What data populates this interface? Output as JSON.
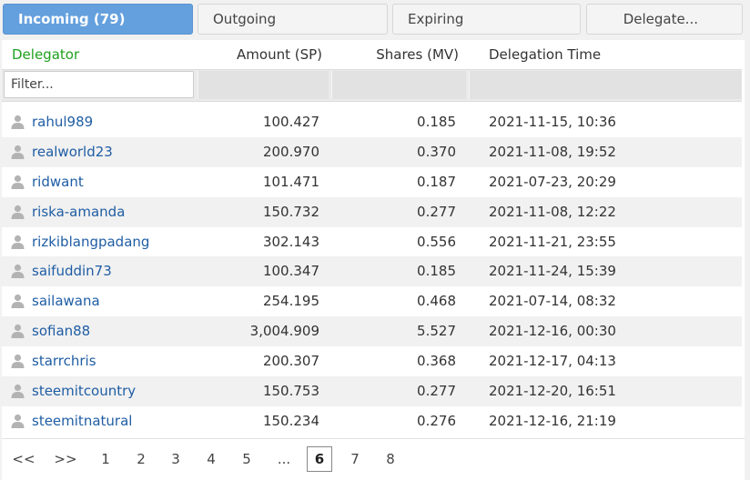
{
  "tabs": {
    "incoming": "Incoming (79)",
    "outgoing": "Outgoing",
    "expiring": "Expiring",
    "delegate": "Delegate..."
  },
  "table": {
    "headers": {
      "delegator": "Delegator",
      "amount": "Amount (SP)",
      "shares": "Shares (MV)",
      "time": "Delegation Time"
    },
    "filter_placeholder": "Filter...",
    "rows": [
      {
        "name": "rahul989",
        "amount": "100.427",
        "shares": "0.185",
        "time": "2021-11-15, 10:36"
      },
      {
        "name": "realworld23",
        "amount": "200.970",
        "shares": "0.370",
        "time": "2021-11-08, 19:52"
      },
      {
        "name": "ridwant",
        "amount": "101.471",
        "shares": "0.187",
        "time": "2021-07-23, 20:29"
      },
      {
        "name": "riska-amanda",
        "amount": "150.732",
        "shares": "0.277",
        "time": "2021-11-08, 12:22"
      },
      {
        "name": "rizkiblangpadang",
        "amount": "302.143",
        "shares": "0.556",
        "time": "2021-11-21, 23:55"
      },
      {
        "name": "saifuddin73",
        "amount": "100.347",
        "shares": "0.185",
        "time": "2021-11-24, 15:39"
      },
      {
        "name": "sailawana",
        "amount": "254.195",
        "shares": "0.468",
        "time": "2021-07-14, 08:32"
      },
      {
        "name": "sofian88",
        "amount": "3,004.909",
        "shares": "5.527",
        "time": "2021-12-16, 00:30"
      },
      {
        "name": "starrchris",
        "amount": "200.307",
        "shares": "0.368",
        "time": "2021-12-17, 04:13"
      },
      {
        "name": "steemitcountry",
        "amount": "150.753",
        "shares": "0.277",
        "time": "2021-12-20, 16:51"
      },
      {
        "name": "steemitnatural",
        "amount": "150.234",
        "shares": "0.276",
        "time": "2021-12-16, 21:19"
      }
    ]
  },
  "pagination": {
    "first": "<<",
    "next": ">>",
    "pages": [
      "1",
      "2",
      "3",
      "4",
      "5",
      "...",
      "6",
      "7",
      "8"
    ],
    "current": "6"
  },
  "icons": {
    "row_avatar": "user-icon"
  },
  "colors": {
    "active_tab": "#64a0de",
    "delegator_header": "#1fa11f",
    "link": "#1f5da4",
    "row_alt": "#f1f1f1"
  }
}
